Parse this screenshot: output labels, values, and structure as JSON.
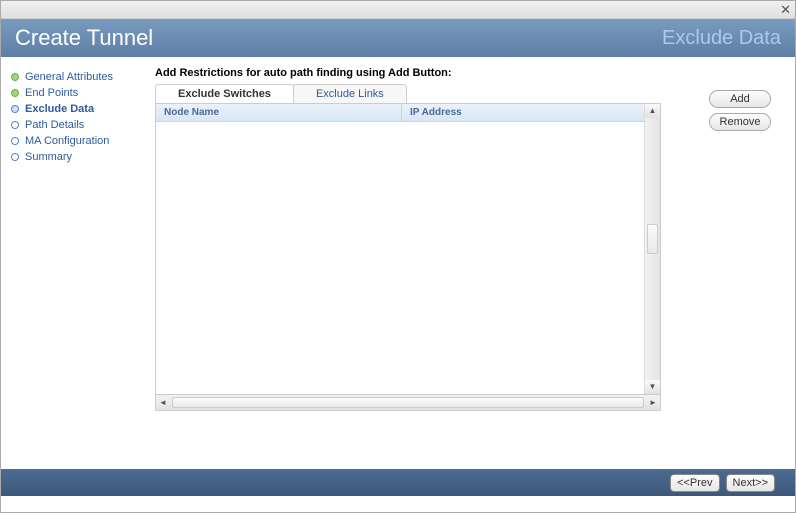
{
  "header": {
    "title": "Create Tunnel",
    "section": "Exclude Data"
  },
  "sidebar": {
    "items": [
      {
        "label": "General Attributes",
        "state": "done"
      },
      {
        "label": "End Points",
        "state": "done"
      },
      {
        "label": "Exclude Data",
        "state": "current"
      },
      {
        "label": "Path Details",
        "state": "upcoming"
      },
      {
        "label": "MA Configuration",
        "state": "upcoming"
      },
      {
        "label": "Summary",
        "state": "upcoming"
      }
    ]
  },
  "main": {
    "instruction": "Add Restrictions for auto path finding using Add Button:",
    "tabs": [
      {
        "label": "Exclude Switches",
        "active": true
      },
      {
        "label": "Exclude Links",
        "active": false
      }
    ],
    "columns": {
      "node": "Node Name",
      "ip": "IP Address"
    },
    "rows": []
  },
  "buttons": {
    "add": "Add",
    "remove": "Remove",
    "prev": "<<Prev",
    "next": "Next>>"
  }
}
